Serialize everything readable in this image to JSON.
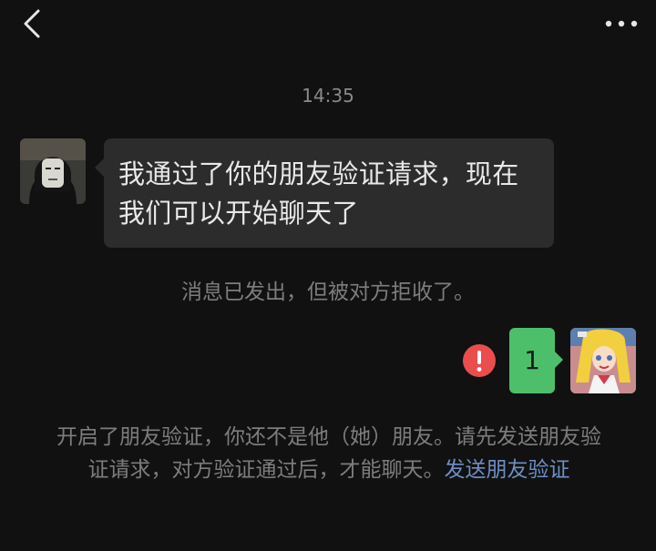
{
  "header": {
    "back_icon": "chevron-left-icon",
    "more_icon": "more-dots-icon"
  },
  "chat": {
    "timestamp": "14:35",
    "incoming_message": {
      "avatar_icon": "masked-person-avatar",
      "text": "我通过了你的朋友验证请求，现在我们可以开始聊天了"
    },
    "rejected_notice": "消息已发出，但被对方拒收了。",
    "outgoing_message": {
      "text": "1",
      "status_icon": "error-exclamation-icon",
      "avatar_icon": "anime-girl-avatar"
    },
    "verify_notice": {
      "text": "开启了朋友验证，你还不是他（她）朋友。请先发送朋友验证请求，对方验证通过后，才能聊天。",
      "link_text": "发送朋友验证"
    }
  },
  "colors": {
    "background": "#111111",
    "incoming_bubble": "#2c2c2c",
    "outgoing_bubble": "#4dbf6b",
    "error_red": "#e94d4d",
    "link_blue": "#6e8fc4",
    "system_text": "#7d7d7d"
  }
}
